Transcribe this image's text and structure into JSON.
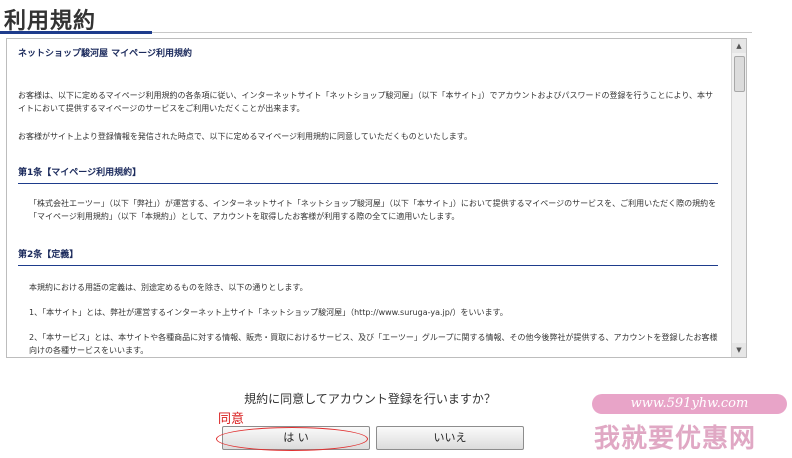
{
  "page_title": "利用規約",
  "doc_title": "ネットショップ駿河屋 マイページ利用規約",
  "intro": [
    "お客様は、以下に定めるマイページ利用規約の各条項に従い、インターネットサイト「ネットショップ駿河屋」（以下「本サイト」）でアカウントおよびパスワードの登録を行うことにより、本サイトにおいて提供するマイページのサービスをご利用いただくことが出来ます。",
    "お客様がサイト上より登録情報を発信された時点で、以下に定めるマイページ利用規約に同意していただくものといたします。"
  ],
  "articles": [
    {
      "heading": "第1条【マイページ利用規約】",
      "paragraphs": [
        "「株式会社エーツー」（以下「弊社」）が運営する、インターネットサイト「ネットショップ駿河屋」（以下「本サイト」）において提供するマイページのサービスを、ご利用いただく際の規約を「マイページ利用規約」（以下「本規約」）として、アカウントを取得したお客様が利用する際の全てに適用いたします。"
      ]
    },
    {
      "heading": "第2条【定義】",
      "paragraphs": [
        "本規約における用語の定義は、別途定めるものを除き、以下の通りとします。",
        "1、「本サイト」とは、弊社が運営するインターネット上サイト「ネットショップ駿河屋」（http://www.suruga-ya.jp/）をいいます。",
        "2、「本サービス」とは、本サイトや各種商品に対する情報、販売・買取におけるサービス、及び「エーツー」グループに関する情報、その他今後弊社が提供する、アカウントを登録したお客様向けの各種サービスをいいます。"
      ]
    }
  ],
  "scrollbar": {
    "up_glyph": "▲",
    "down_glyph": "▼"
  },
  "question": "規約に同意してアカウント登録を行いますか？",
  "annotation": "同意",
  "buttons": {
    "yes_label": "は い",
    "no_label": "いいえ"
  },
  "watermark": {
    "url": "www.591yhw.com",
    "brand": "我就要优惠网"
  },
  "colors": {
    "accent": "#1e3c8c",
    "annotation": "#d81b1b",
    "watermark": "#e0a8c4"
  }
}
